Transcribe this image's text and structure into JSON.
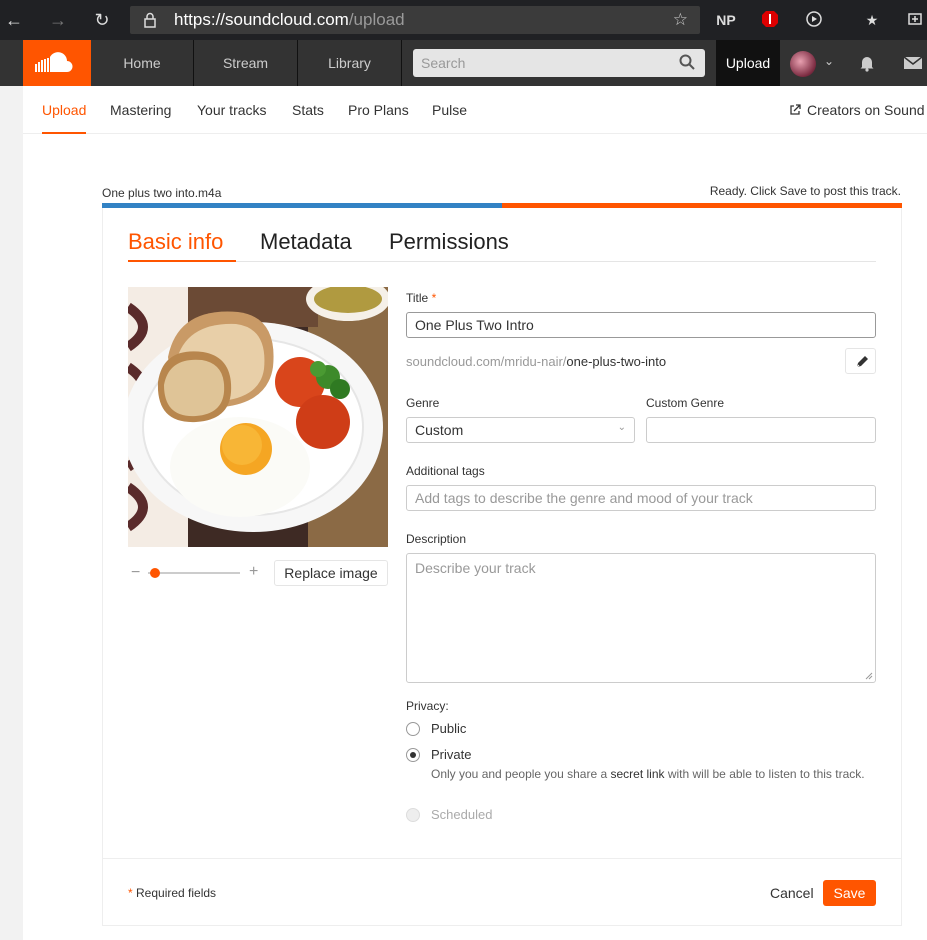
{
  "browser": {
    "url_base": "https://soundcloud.com",
    "url_path": "/upload",
    "ext_np": "NP"
  },
  "header": {
    "nav": [
      "Home",
      "Stream",
      "Library"
    ],
    "search_placeholder": "Search",
    "upload_label": "Upload",
    "brand_color": "#ff5500"
  },
  "subnav": {
    "items": [
      "Upload",
      "Mastering",
      "Your tracks",
      "Stats",
      "Pro Plans",
      "Pulse"
    ],
    "creators_link": "Creators on Sound"
  },
  "upload": {
    "file_name": "One plus two into.m4a",
    "status": "Ready. Click Save to post this track.",
    "progress": 0.5
  },
  "tabs": [
    "Basic info",
    "Metadata",
    "Permissions"
  ],
  "form": {
    "title_label": "Title",
    "required_mark": "*",
    "title_value": "One Plus Two Intro",
    "permalink_base": "soundcloud.com/mridu-nair/",
    "permalink_slug": "one-plus-two-into",
    "genre_label": "Genre",
    "genre_value": "Custom",
    "custom_genre_label": "Custom Genre",
    "custom_genre_value": "",
    "tags_label": "Additional tags",
    "tags_placeholder": "Add tags to describe the genre and mood of your track",
    "description_label": "Description",
    "description_placeholder": "Describe your track",
    "privacy_label": "Privacy:",
    "privacy_options": [
      "Public",
      "Private",
      "Scheduled"
    ],
    "privacy_selected": "Private",
    "privacy_note_1": "Only you and people you share a ",
    "privacy_note_link": "secret link",
    "privacy_note_2": " with will be able to listen to this track."
  },
  "artwork": {
    "replace_label": "Replace image",
    "zoom_minus": "−",
    "zoom_plus": "+",
    "zoom_level": 0.05
  },
  "footer": {
    "required_note": "Required fields",
    "cancel_label": "Cancel",
    "save_label": "Save"
  }
}
